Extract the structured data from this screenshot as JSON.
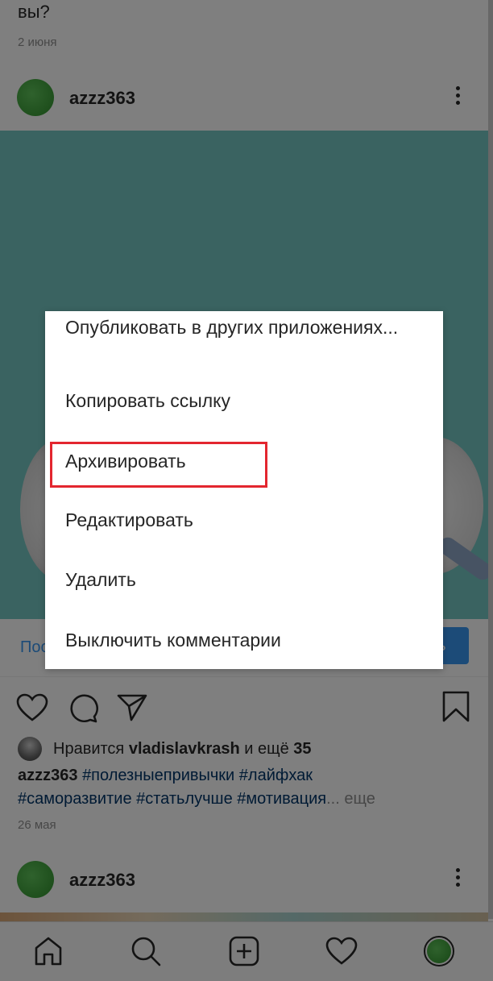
{
  "prev_post": {
    "caption_tail": "вы?",
    "date": "2 июня"
  },
  "post": {
    "username": "azzz363",
    "cta_left": "Пос",
    "cta_right": "ть",
    "likes": {
      "prefix": "Нравится",
      "user": "vladislavkrash",
      "middle": "и ещё",
      "count": "35"
    },
    "caption": {
      "user": "azzz363",
      "tags_line1": "#полезныепривычки #лайфхак",
      "tags_line2": "#саморазвитие #статьлучше #мотивация",
      "ellipsis": "...",
      "more": "еще"
    },
    "date": "26 мая"
  },
  "next_post": {
    "username": "azzz363"
  },
  "dialog": {
    "items": [
      "Опубликовать в других приложениях...",
      "Копировать ссылку",
      "Архивировать",
      "Редактировать",
      "Удалить",
      "Выключить комментарии"
    ],
    "highlighted": "Архивировать"
  },
  "nav": {
    "icons": [
      "home-icon",
      "search-icon",
      "new-post-icon",
      "activity-icon",
      "profile-avatar"
    ]
  },
  "colors": {
    "image_bg": "#75c7c2",
    "link_blue": "#3897f0",
    "hashtag": "#003569",
    "highlight_border": "#e3262f"
  }
}
